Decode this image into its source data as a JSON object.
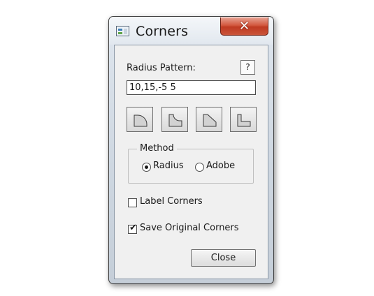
{
  "window": {
    "title": "Corners",
    "close_glyph": "✕",
    "app_icon": "app-icon"
  },
  "radius": {
    "label": "Radius Pattern:",
    "help_label": "?",
    "value": "10,15,-5 5"
  },
  "corner_buttons": [
    {
      "name": "round-corner",
      "icon": "round-corner-icon"
    },
    {
      "name": "inverted-round-corner",
      "icon": "inverted-round-corner-icon"
    },
    {
      "name": "bevel-corner",
      "icon": "bevel-corner-icon"
    },
    {
      "name": "notch-corner",
      "icon": "notch-corner-icon"
    }
  ],
  "method": {
    "legend": "Method",
    "options": [
      {
        "label": "Radius",
        "selected": true
      },
      {
        "label": "Adobe",
        "selected": false
      }
    ]
  },
  "options": {
    "label_corners": {
      "label": "Label Corners",
      "checked": false
    },
    "save_original": {
      "label": "Save Original Corners",
      "checked": true
    },
    "check_glyph": "✔"
  },
  "footer": {
    "close_label": "Close"
  }
}
